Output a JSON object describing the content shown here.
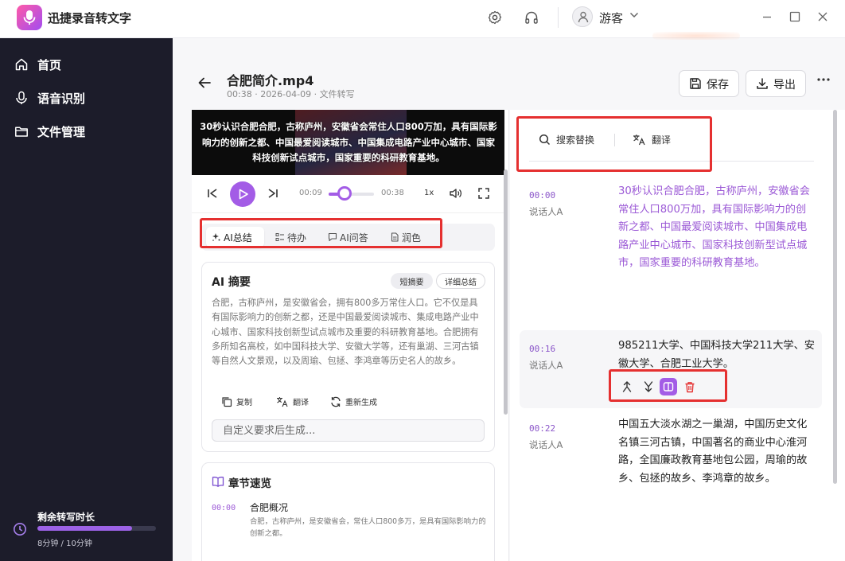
{
  "app": {
    "name": "迅捷录音转文字"
  },
  "user": {
    "name": "游客"
  },
  "sidebar": {
    "items": [
      {
        "label": "首页"
      },
      {
        "label": "语音识别"
      },
      {
        "label": "文件管理"
      }
    ],
    "quota": {
      "title": "剩余转写时长",
      "text": "8分钟 / 10分钟",
      "fraction": 0.8
    }
  },
  "file": {
    "title": "合肥简介.mp4",
    "meta": "00:38 · 2026-04-09 · 文件转写"
  },
  "header": {
    "save_label": "保存",
    "export_label": "导出"
  },
  "video": {
    "subtitle": "30秒认识合肥合肥，古称庐州，安徽省会常住人口800万加，具有国际影响力的创新之都、中国最爱阅读城市、中国集成电路产业中心城市、国家科技创新试点城市，国家重要的科研教育基地。"
  },
  "player": {
    "current": "00:09",
    "duration": "00:38",
    "progress": 0.24,
    "speed": "1x"
  },
  "tabs": [
    {
      "label": "AI总结",
      "active": true
    },
    {
      "label": "待办",
      "active": false
    },
    {
      "label": "AI问答",
      "active": false
    },
    {
      "label": "润色",
      "active": false
    }
  ],
  "summary": {
    "title": "AI 摘要",
    "mode_short": "短摘要",
    "mode_detail": "详细总结",
    "text": "合肥，古称庐州，是安徽省会，拥有800多万常住人口。它不仅是具有国际影响力的创新之都，还是中国最爱阅读城市、集成电路产业中心城市、国家科技创新型试点城市及重要的科研教育基地。合肥拥有多所知名高校，如中国科技大学、安徽大学等，还有巢湖、三河古镇等自然人文景观，以及周瑜、包拯、李鸿章等历史名人的故乡。",
    "copy_label": "复制",
    "translate_label": "翻译",
    "regen_label": "重新生成",
    "input_placeholder": "自定义要求后生成..."
  },
  "chapters": {
    "title": "章节速览",
    "items": [
      {
        "time": "00:00",
        "name": "合肥概况",
        "desc": "合肥，古称庐州，是安徽省会，常住人口800多万，是具有国际影响力的创新之都。"
      }
    ]
  },
  "transcript_tools": {
    "search_label": "搜索替换",
    "translate_label": "翻译"
  },
  "segments": [
    {
      "time": "00:00",
      "speaker": "说话人A",
      "text": "30秒认识合肥合肥，古称庐州，安徽省会常住人口800万加，具有国际影响力的创新之都、中国最爱阅读城市、中国集成电路产业中心城市、国家科技创新型试点城市，国家重要的科研教育基地。"
    },
    {
      "time": "00:16",
      "speaker": "说话人A",
      "text": "985211大学、中国科技大学211大学、安徽大学、合肥工业大学。"
    },
    {
      "time": "00:22",
      "speaker": "说话人A",
      "text": "中国五大淡水湖之一巢湖，中国历史文化名镇三河古镇，中国著名的商业中心淮河路，全国廉政教育基地包公园，周瑜的故乡、包拯的故乡、李鸿章的故乡。"
    }
  ],
  "colors": {
    "accent": "#a35ce6",
    "sidebar_bg": "#1c1c2a",
    "highlight_text": "#9b59d6",
    "annotation": "#e53030",
    "delete": "#e53535"
  }
}
